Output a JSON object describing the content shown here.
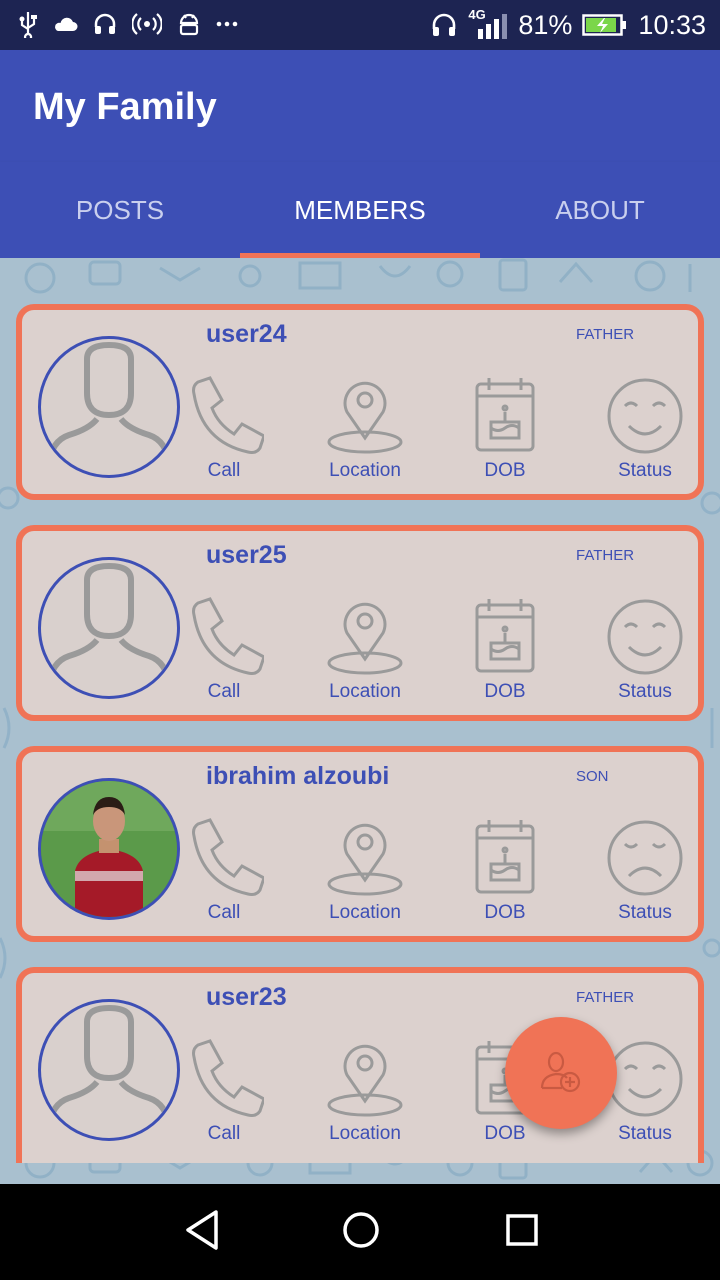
{
  "status_bar": {
    "network": "4G",
    "battery": "81%",
    "time": "10:33"
  },
  "app": {
    "title": "My Family"
  },
  "tabs": [
    {
      "label": "POSTS",
      "active": false
    },
    {
      "label": "MEMBERS",
      "active": true
    },
    {
      "label": "ABOUT",
      "active": false
    }
  ],
  "members": [
    {
      "name": "user24",
      "role": "FATHER",
      "avatar": "default-avatar",
      "status_icon": "smile-icon"
    },
    {
      "name": "user25",
      "role": "FATHER",
      "avatar": "default-avatar",
      "status_icon": "smile-icon"
    },
    {
      "name": "ibrahim alzoubi",
      "role": "SON",
      "avatar": "photo-avatar",
      "status_icon": "sad-icon"
    },
    {
      "name": "user23",
      "role": "FATHER",
      "avatar": "default-avatar",
      "status_icon": "smile-icon"
    }
  ],
  "actions": {
    "call": "Call",
    "location": "Location",
    "dob": "DOB",
    "status": "Status"
  },
  "fab": {
    "icon": "add-member-icon"
  },
  "colors": {
    "primary": "#3d4fb5",
    "accent": "#f07356",
    "card_bg": "#dcd1ce",
    "icon_gray": "#9a9a9a"
  }
}
